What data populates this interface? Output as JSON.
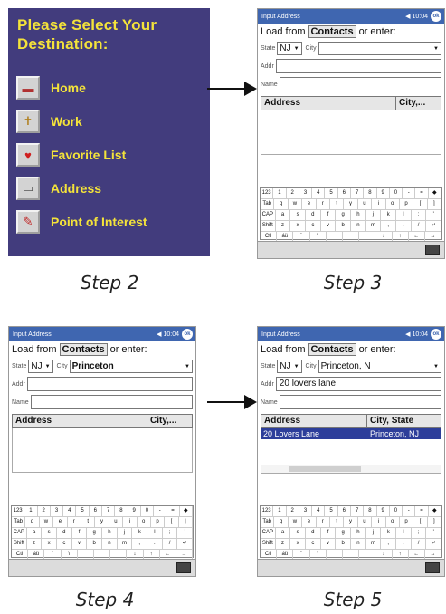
{
  "menu": {
    "title": "Please Select Your Destination:",
    "items": [
      {
        "label": "Home",
        "icon": "house-icon"
      },
      {
        "label": "Work",
        "icon": "briefcase-icon"
      },
      {
        "label": "Favorite List",
        "icon": "heart-icon"
      },
      {
        "label": "Address",
        "icon": "mailbox-icon"
      },
      {
        "label": "Point of Interest",
        "icon": "pushpin-icon"
      }
    ]
  },
  "captions": {
    "step2": "Step 2",
    "step3": "Step 3",
    "step4": "Step 4",
    "step5": "Step 5"
  },
  "common": {
    "window_title": "Input Address",
    "status": "◀ 10:04",
    "ok_label": "ok",
    "load_from": "Load from",
    "contacts_button": "Contacts",
    "or_enter": "or enter:",
    "state_label": "State",
    "city_label": "City",
    "addr_label": "Addr",
    "name_label": "Name",
    "col_address": "Address",
    "col_city_short": "City,...",
    "col_city_state": "City, State"
  },
  "step3": {
    "state": "NJ",
    "city": "",
    "addr": "",
    "name": ""
  },
  "step4": {
    "state": "NJ",
    "city": "Princeton",
    "addr": "",
    "name": ""
  },
  "step5": {
    "state": "NJ",
    "city": "Princeton, N",
    "addr": "20 lovers lane",
    "name": "",
    "result_address": "20 Lovers Lane",
    "result_city": "Princeton, NJ"
  },
  "keyboard_rows": [
    [
      "123",
      "1",
      "2",
      "3",
      "4",
      "5",
      "6",
      "7",
      "8",
      "9",
      "0",
      "-",
      "=",
      "◆"
    ],
    [
      "Tab",
      "q",
      "w",
      "e",
      "r",
      "t",
      "y",
      "u",
      "i",
      "o",
      "p",
      "[",
      "]"
    ],
    [
      "CAP",
      "a",
      "s",
      "d",
      "f",
      "g",
      "h",
      "j",
      "k",
      "l",
      ";",
      "'"
    ],
    [
      "Shift",
      "z",
      "x",
      "c",
      "v",
      "b",
      "n",
      "m",
      ",",
      ".",
      "/",
      "↵"
    ],
    [
      "Ctl",
      "áü",
      "`",
      "\\",
      "",
      "",
      "",
      "↓",
      "↑",
      "←",
      "→"
    ]
  ],
  "colors": {
    "menu_bg": "#423c7d",
    "menu_text": "#f4e33a",
    "title_bar": "#3f66b0",
    "selected_row": "#2d3e9a"
  }
}
